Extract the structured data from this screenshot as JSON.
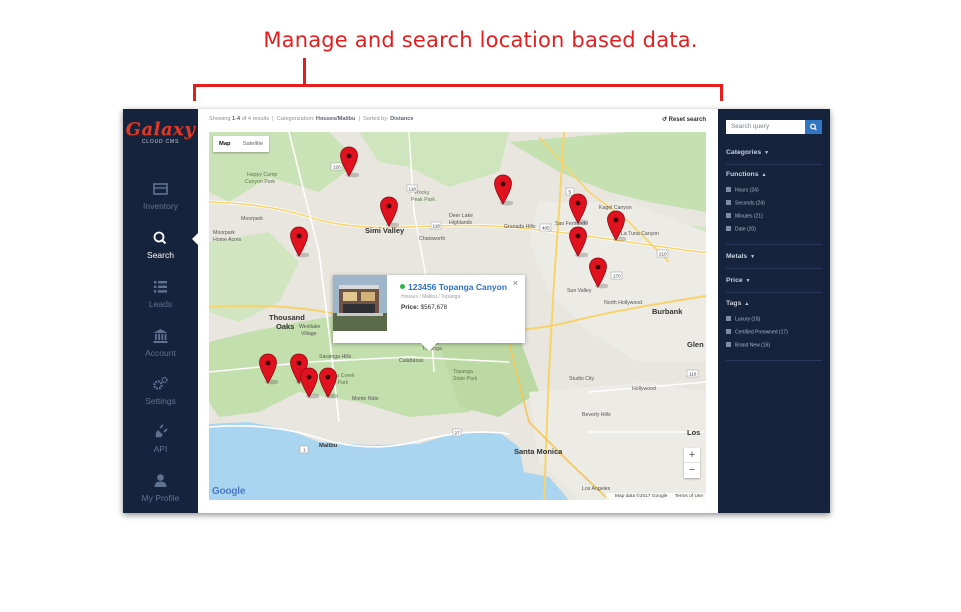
{
  "caption": "Manage and search location based data.",
  "colors": {
    "annotation": "#e41e1e",
    "sidebar_bg": "#15233d",
    "accent": "#3276c3",
    "brand": "#d93a2b",
    "pin": "#e0121f"
  },
  "brand": {
    "name": "Galaxy",
    "tagline": "CLOUD CMS"
  },
  "sidebar": {
    "items": [
      {
        "label": "Inventory",
        "icon": "inventory-icon"
      },
      {
        "label": "Search",
        "icon": "search-icon",
        "active": true
      },
      {
        "label": "Leads",
        "icon": "list-icon"
      },
      {
        "label": "Account",
        "icon": "bank-icon"
      },
      {
        "label": "Settings",
        "icon": "gears-icon"
      },
      {
        "label": "API",
        "icon": "plug-icon"
      },
      {
        "label": "My Profile",
        "icon": "user-icon"
      }
    ]
  },
  "results_bar": {
    "showing_prefix": "Showing",
    "showing_range": "1-4",
    "showing_suffix": "of 4 results",
    "category_prefix": "Categorization:",
    "category_value": "Houses/Malibu",
    "sort_prefix": "Sorted by:",
    "sort_value": "Distance",
    "reset_label": "Reset search"
  },
  "map": {
    "type_options": [
      "Map",
      "Satellite"
    ],
    "selected_type": "Map",
    "zoom_in": "+",
    "zoom_out": "−",
    "google_label": "Google",
    "map_data": "Map data ©2017 Google",
    "terms": "Terms of Use",
    "place_labels": [
      "Happy Camp Canyon Park",
      "Rocky Peak Park",
      "Deer Lake Highlands",
      "San Fernando",
      "Kagel Canyon",
      "Moorpark",
      "Simi Valley",
      "Moorpark Home Acres",
      "Granada Hills",
      "La Tuna Canyon",
      "Thousand Oaks",
      "Burbank",
      "Glen",
      "Westlake Village",
      "Saratoga Hills",
      "Calabasas",
      "Malibu Creek State Park",
      "Topanga State Park",
      "Monte Nido",
      "Beverly Hills",
      "Santa Monica",
      "Malibu",
      "Los",
      "Los Angeles",
      "Studio City",
      "Hollywood",
      "Chatsworth",
      "North Hollywood",
      "Sun Valley",
      "Topanga"
    ],
    "road_numbers": [
      "126",
      "118",
      "118",
      "405",
      "5",
      "210",
      "101",
      "27",
      "1",
      "110",
      "170"
    ]
  },
  "popup": {
    "title": "123456 Topanga Canyon",
    "subtitle": "Houses / Malibu / Topanga",
    "price_label": "Price:",
    "price_value": "$567,678",
    "close_label": "×"
  },
  "filters": {
    "search_placeholder": "Search query",
    "sections": [
      {
        "label": "Categories",
        "caret": "▼"
      },
      {
        "label": "Functions",
        "caret": "▲",
        "items": [
          "Hours (24)",
          "Seconds (24)",
          "Minutes (21)",
          "Date (20)"
        ]
      },
      {
        "label": "Metals",
        "caret": "▼"
      },
      {
        "label": "Price",
        "caret": "▼"
      },
      {
        "label": "Tags",
        "caret": "▲",
        "items": [
          "Luxury (16)",
          "Certified Preowned (17)",
          "Brand New (16)"
        ]
      }
    ]
  }
}
